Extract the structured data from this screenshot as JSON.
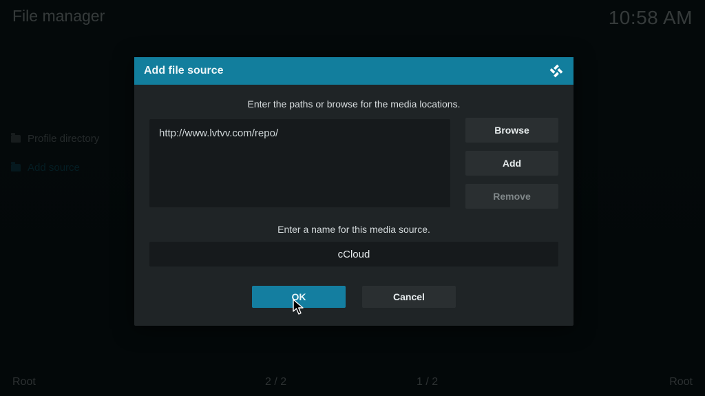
{
  "header": {
    "title": "File manager",
    "clock": "10:58 AM"
  },
  "sidebar": {
    "items": [
      {
        "label": "Profile directory"
      },
      {
        "label": "Add source"
      }
    ]
  },
  "footer": {
    "root_left": "Root",
    "count_left": "2 / 2",
    "count_right": "1 / 2",
    "root_right": "Root"
  },
  "dialog": {
    "title": "Add file source",
    "path_instruction": "Enter the paths or browse for the media locations.",
    "paths": [
      "http://www.lvtvv.com/repo/"
    ],
    "browse_label": "Browse",
    "add_label": "Add",
    "remove_label": "Remove",
    "name_instruction": "Enter a name for this media source.",
    "name_value": "cCloud",
    "ok_label": "OK",
    "cancel_label": "Cancel"
  }
}
